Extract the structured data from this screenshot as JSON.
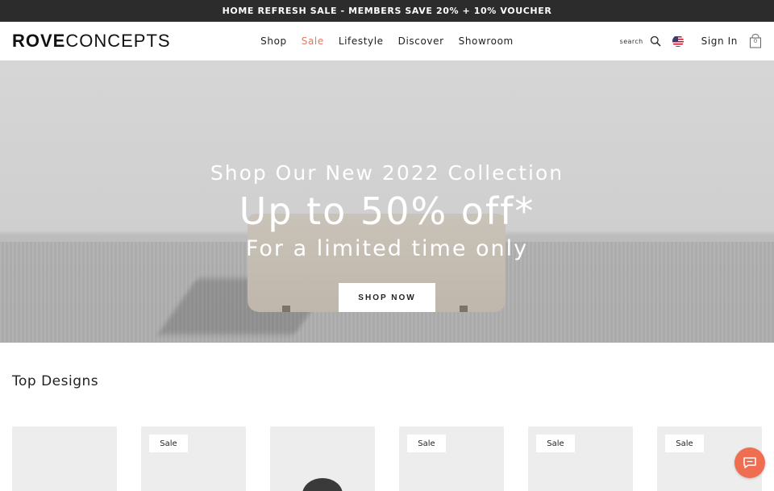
{
  "promo": {
    "text": "HOME REFRESH SALE - MEMBERS SAVE 20% + 10% VOUCHER"
  },
  "logo": {
    "bold": "ROVE",
    "light": "CONCEPTS"
  },
  "nav": [
    {
      "label": "Shop"
    },
    {
      "label": "Sale"
    },
    {
      "label": "Lifestyle"
    },
    {
      "label": "Discover"
    },
    {
      "label": "Showroom"
    }
  ],
  "header": {
    "search_label": "search",
    "sign_in": "Sign In",
    "cart_count": "0"
  },
  "hero": {
    "subtitle": "Shop Our New 2022 Collection",
    "headline": "Up to 50% off*",
    "tagline": "For a limited time only",
    "cta": "SHOP NOW"
  },
  "section": {
    "title": "Top Designs"
  },
  "products": [
    {
      "badge": ""
    },
    {
      "badge": "Sale"
    },
    {
      "badge": ""
    },
    {
      "badge": "Sale"
    },
    {
      "badge": "Sale"
    },
    {
      "badge": "Sale"
    }
  ],
  "colors": {
    "accent": "#ef6d50",
    "sale_link": "#e07a5f",
    "promo_bg": "#2c2c2c"
  },
  "icons": [
    "search-icon",
    "us-flag-icon",
    "shopping-bag-icon",
    "chat-icon"
  ]
}
